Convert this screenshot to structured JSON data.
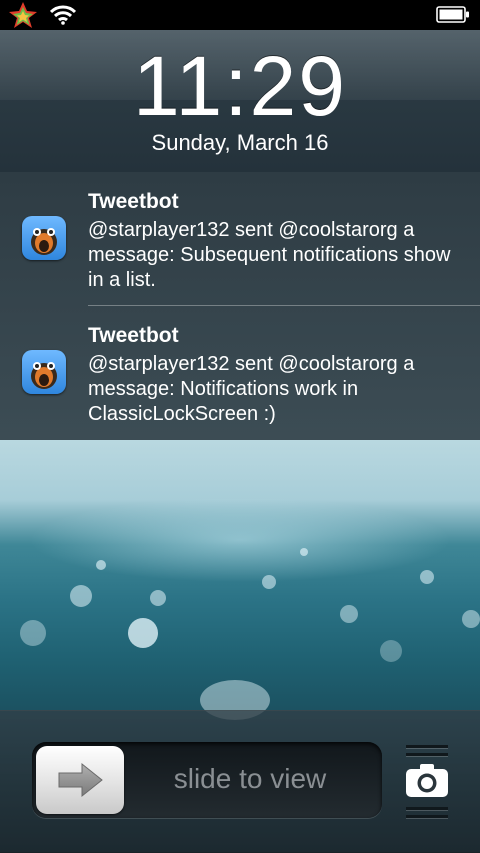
{
  "status_bar": {
    "app_icon": "star-icon",
    "signal_icon": "wifi-icon",
    "battery_icon": "battery-icon"
  },
  "lock": {
    "time": "11:29",
    "date": "Sunday, March 16"
  },
  "notifications": [
    {
      "app": "Tweetbot",
      "icon": "tweetbot-icon",
      "message": "@starplayer132 sent @coolstarorg a message: Subsequent notifications show in a list."
    },
    {
      "app": "Tweetbot",
      "icon": "tweetbot-icon",
      "message": "@starplayer132 sent @coolstarorg a message: Notifications work in ClassicLockScreen :)"
    }
  ],
  "unlock": {
    "label": "slide to view",
    "knob_icon": "arrow-right-icon",
    "camera_icon": "camera-icon"
  }
}
